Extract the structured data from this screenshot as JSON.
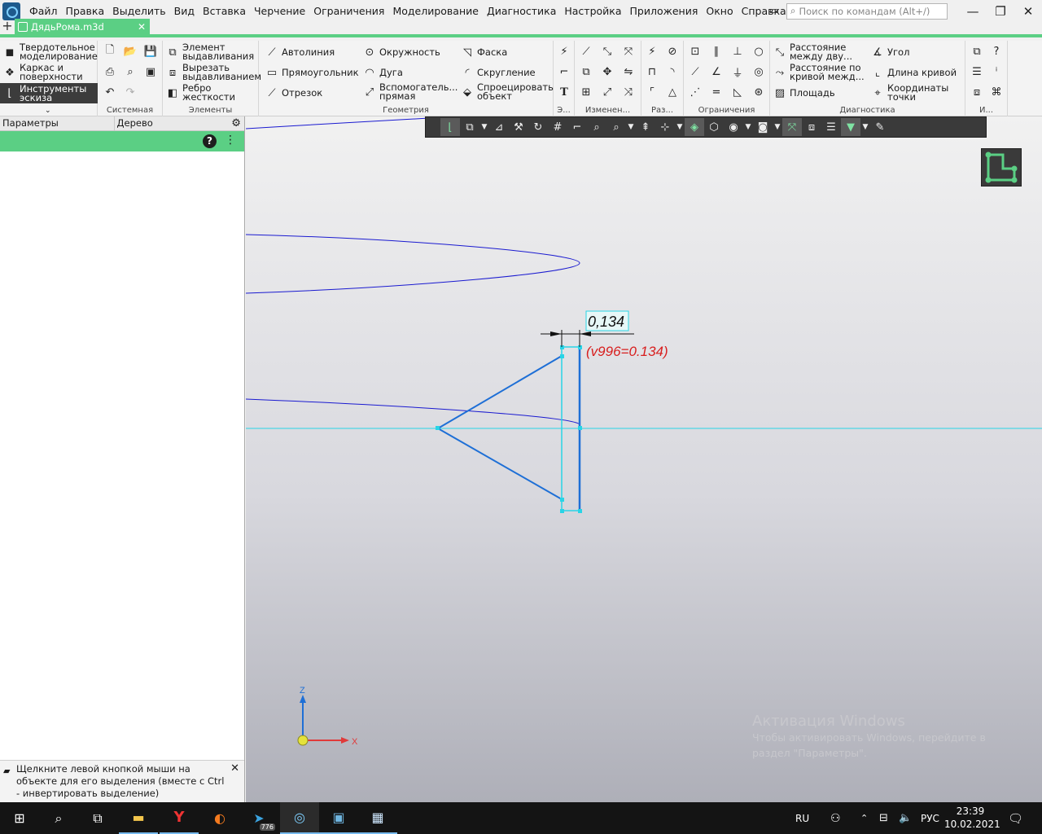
{
  "menu": [
    "Файл",
    "Правка",
    "Выделить",
    "Вид",
    "Вставка",
    "Черчение",
    "Ограничения",
    "Моделирование",
    "Диагностика",
    "Настройка",
    "Приложения",
    "Окно",
    "Справка"
  ],
  "search": {
    "placeholder": "Поиск по командам (Alt+/)"
  },
  "document_tab": {
    "title": "ДядьРома.m3d"
  },
  "ribbon": {
    "modes": [
      "Твердотельное\nмоделирование",
      "Каркас и\nповерхности",
      "Инструменты\nэскиза"
    ],
    "groups": {
      "system": "Системная",
      "elements": "Элементы",
      "geometry": "Геометрия",
      "edit": "Э...",
      "modify": "Изменен...",
      "dims": "Раз...",
      "constraints": "Ограничения",
      "diagnostics": "Диагностика",
      "misc": "И..."
    },
    "elements_buttons": [
      "Элемент\nвыдавливания",
      "Вырезать\nвыдавливанием",
      "Ребро\nжесткости"
    ],
    "geometry_buttons": [
      "Автолиния",
      "Окружность",
      "Фаска",
      "Прямоугольник",
      "Дуга",
      "Скругление",
      "Отрезок",
      "Вспомогатель...\nпрямая",
      "Спроецировать\nобъект"
    ],
    "diagnostics_buttons": [
      "Расстояние\nмежду дву...",
      "Угол",
      "Расстояние по\nкривой межд...",
      "Длина кривой",
      "Площадь",
      "Координаты\nточки"
    ]
  },
  "left_panel": {
    "tabs": [
      "Параметры",
      "Дерево"
    ],
    "hint": "Щелкните левой кнопкой мыши на объекте для его выделения (вместе с Ctrl - инвертировать выделение)"
  },
  "viewport": {
    "dimension_value": "0,134",
    "variable_label": "(v996=0.134)",
    "axis_z": "Z",
    "axis_x": "X",
    "activation_title": "Активация Windows",
    "activation_text": "Чтобы активировать Windows, перейдите в раздел \"Параметры\"."
  },
  "taskbar": {
    "telegram_badge": "776",
    "lang": "RU",
    "keyboard": "РУС",
    "time": "23:39",
    "date": "10.02.2021"
  },
  "colors": {
    "accent_green": "#5bcf84",
    "sketch_blue": "#1e6fd6",
    "selection_cyan": "#29d4e6",
    "variable_red": "#d81e1e",
    "curve_blue": "#1a1ad0"
  }
}
